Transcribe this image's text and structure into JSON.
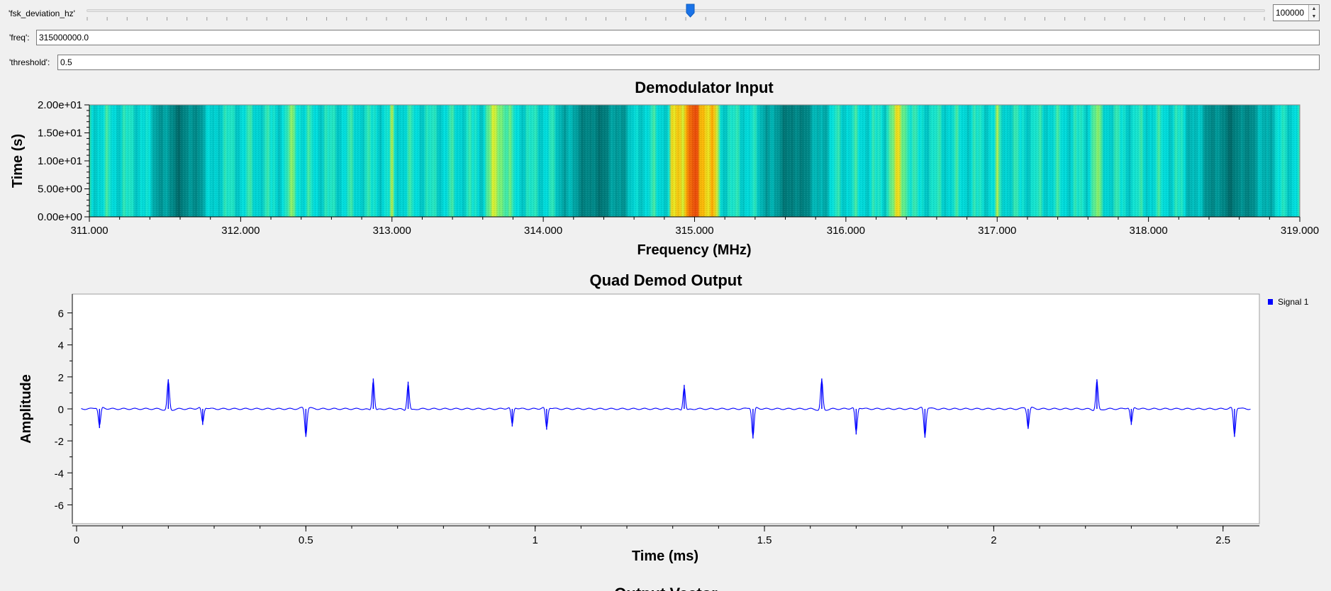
{
  "controls": {
    "deviation": {
      "label": "'fsk_deviation_hz'",
      "value": "100000",
      "position_fraction": 0.508
    },
    "freq": {
      "label": "'freq':",
      "value": "315000000.0"
    },
    "threshold": {
      "label": "'threshold':",
      "value": "0.5"
    }
  },
  "colors": {
    "signal": "#0000ff",
    "waterfall_low": "#007070",
    "waterfall_mid": "#00ffff",
    "waterfall_high": "#ff4400",
    "slider_handle": "#1a73e8"
  },
  "waterfall": {
    "title": "Demodulator Input",
    "xlabel": "Frequency (MHz)",
    "ylabel": "Time (s)",
    "x_ticks": [
      "311.000",
      "312.000",
      "313.000",
      "314.000",
      "315.000",
      "316.000",
      "317.000",
      "318.000",
      "319.000"
    ],
    "y_ticks": [
      "0.00e+00",
      "5.00e+00",
      "1.00e+01",
      "1.50e+01",
      "2.00e+01"
    ]
  },
  "timeplot": {
    "title": "Quad Demod Output",
    "xlabel": "Time (ms)",
    "ylabel": "Amplitude",
    "x_ticks": [
      "0",
      "0.5",
      "1",
      "1.5",
      "2",
      "2.5"
    ],
    "y_ticks": [
      "6",
      "4",
      "2",
      "0",
      "-2",
      "-4",
      "-6"
    ],
    "legend": "Signal 1"
  },
  "next_title": "Output Vector",
  "chart_data": [
    {
      "type": "heatmap",
      "title": "Demodulator Input",
      "xlabel": "Frequency (MHz)",
      "ylabel": "Time (s)",
      "xlim": [
        311.0,
        319.0
      ],
      "ylim": [
        0.0,
        20.0
      ],
      "x_ticks": [
        311,
        312,
        313,
        314,
        315,
        316,
        317,
        318,
        319
      ],
      "y_ticks": [
        0,
        5,
        10,
        15,
        20
      ],
      "bright_bands_mhz": [
        {
          "center": 315.0,
          "width": 0.32,
          "level": "high"
        },
        {
          "center": 313.7,
          "width": 0.18,
          "level": "mid-high"
        },
        {
          "center": 316.35,
          "width": 0.18,
          "level": "mid-high"
        },
        {
          "center": 312.35,
          "width": 0.15,
          "level": "mid"
        },
        {
          "center": 317.65,
          "width": 0.15,
          "level": "mid"
        },
        {
          "center": 313.0,
          "width": 0.03,
          "level": "mid"
        },
        {
          "center": 317.0,
          "width": 0.03,
          "level": "mid"
        }
      ],
      "dark_bands_mhz": [
        {
          "center": 311.6,
          "width": 0.4
        },
        {
          "center": 314.35,
          "width": 0.5
        },
        {
          "center": 315.65,
          "width": 0.45
        },
        {
          "center": 318.55,
          "width": 0.55
        }
      ]
    },
    {
      "type": "line",
      "title": "Quad Demod Output",
      "xlabel": "Time (ms)",
      "ylabel": "Amplitude",
      "xlim": [
        0,
        2.57
      ],
      "ylim": [
        -7,
        7
      ],
      "baseline": 0,
      "series": [
        {
          "name": "Signal 1",
          "spikes": [
            {
              "x": 0.05,
              "y": -1.2
            },
            {
              "x": 0.2,
              "y": 1.85
            },
            {
              "x": 0.275,
              "y": -1.0
            },
            {
              "x": 0.5,
              "y": -1.75
            },
            {
              "x": 0.647,
              "y": 1.9
            },
            {
              "x": 0.723,
              "y": 1.7
            },
            {
              "x": 0.95,
              "y": -1.1
            },
            {
              "x": 1.025,
              "y": -1.3
            },
            {
              "x": 1.325,
              "y": 1.5
            },
            {
              "x": 1.475,
              "y": -1.85
            },
            {
              "x": 1.625,
              "y": 1.9
            },
            {
              "x": 1.7,
              "y": -1.6
            },
            {
              "x": 1.85,
              "y": -1.8
            },
            {
              "x": 2.075,
              "y": -1.25
            },
            {
              "x": 2.225,
              "y": 1.85
            },
            {
              "x": 2.3,
              "y": -1.0
            },
            {
              "x": 2.525,
              "y": -1.75
            }
          ]
        }
      ]
    }
  ]
}
